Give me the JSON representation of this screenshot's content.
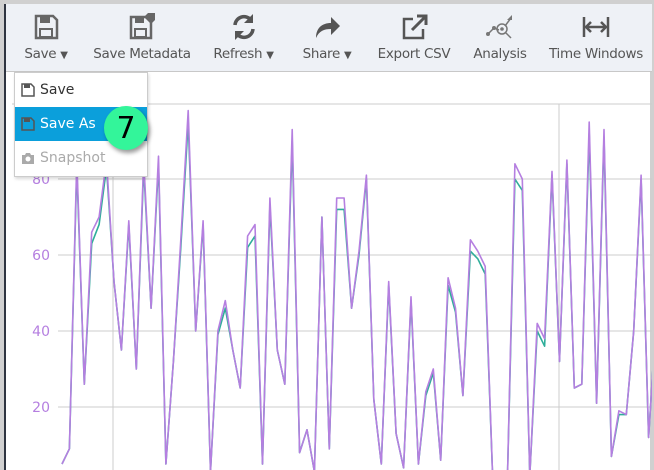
{
  "toolbar": {
    "items": [
      {
        "label": "Save",
        "icon": "floppy-disk-icon",
        "dropdown": true
      },
      {
        "label": "Save Metadata",
        "icon": "floppy-tag-icon"
      },
      {
        "label": "Refresh",
        "icon": "refresh-icon",
        "dropdown": true
      },
      {
        "label": "Share",
        "icon": "share-arrow-icon",
        "dropdown": true
      },
      {
        "label": "Export CSV",
        "icon": "external-link-icon"
      },
      {
        "label": "Analysis",
        "icon": "analysis-icon"
      },
      {
        "label": "Time Windows",
        "icon": "arrows-horizontal-icon"
      }
    ]
  },
  "save_menu": {
    "items": [
      {
        "label": "Save",
        "icon": "floppy-disk-icon",
        "state": "normal"
      },
      {
        "label": "Save As",
        "icon": "floppy-disk-icon",
        "state": "highlighted"
      },
      {
        "label": "Snapshot",
        "icon": "camera-icon",
        "state": "disabled"
      }
    ]
  },
  "badge": {
    "number": "7",
    "color": "#33f59a"
  },
  "colors": {
    "accent": "#0b9fdb",
    "series_purple": "#b57fe0",
    "series_teal": "#2fae9a"
  },
  "chart_data": {
    "type": "line",
    "title": "",
    "xlabel": "",
    "ylabel": "",
    "yticks": [
      "20",
      "40",
      "60",
      "80"
    ],
    "ytick_values": [
      20,
      40,
      60,
      80
    ],
    "ylim": [
      0,
      100
    ],
    "grid": true,
    "series": [
      {
        "name": "purple",
        "color": "#b57fe0",
        "values": [
          5,
          9,
          85,
          26,
          66,
          70,
          85,
          53,
          35,
          69,
          30,
          85,
          46,
          86,
          5,
          32,
          64,
          98,
          40,
          69,
          3,
          40,
          48,
          35,
          25,
          65,
          68,
          5,
          75,
          35,
          26,
          93,
          8,
          14,
          3,
          70,
          9,
          75,
          75,
          46,
          61,
          81,
          22,
          5,
          53,
          13,
          4,
          49,
          5,
          24,
          30,
          6,
          54,
          46,
          23,
          64,
          61,
          57,
          2,
          2,
          2,
          84,
          80,
          2,
          42,
          38,
          82,
          32,
          85,
          25,
          26,
          95,
          21,
          93,
          7,
          19,
          18,
          40,
          81,
          12,
          43
        ]
      },
      {
        "name": "teal",
        "color": "#2fae9a",
        "values": [
          5,
          9,
          83,
          26,
          63,
          68,
          83,
          53,
          35,
          68,
          30,
          83,
          46,
          84,
          5,
          32,
          62,
          95,
          40,
          68,
          3,
          39,
          46,
          35,
          25,
          62,
          65,
          5,
          73,
          35,
          26,
          90,
          8,
          14,
          3,
          70,
          9,
          72,
          72,
          46,
          60,
          80,
          22,
          5,
          52,
          13,
          4,
          48,
          5,
          23,
          29,
          6,
          52,
          45,
          23,
          61,
          59,
          55,
          2,
          2,
          2,
          80,
          77,
          2,
          40,
          36,
          81,
          32,
          84,
          25,
          26,
          92,
          21,
          91,
          7,
          18,
          18,
          40,
          80,
          12,
          43
        ]
      }
    ]
  }
}
